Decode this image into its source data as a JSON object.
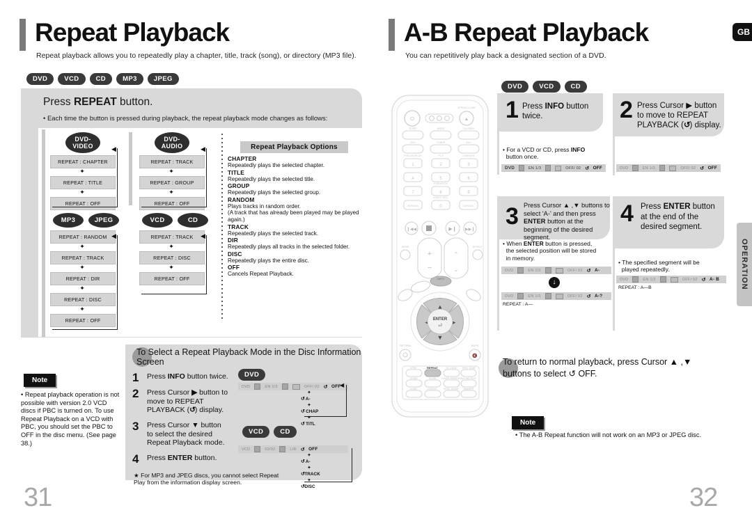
{
  "left_page": {
    "number": "31",
    "title": "Repeat Playback",
    "subtitle": "Repeat playback allows you to repeatedly play a chapter, title, track (song), or directory (MP3 file).",
    "disc_chips": [
      "DVD",
      "VCD",
      "CD",
      "MP3",
      "JPEG"
    ],
    "instruction_heading_pre": "Press ",
    "instruction_heading_bold": "REPEAT",
    "instruction_heading_post": " button.",
    "instruction_bullet": "• Each time the button is pressed during playback, the repeat playback mode changes as follows:",
    "flows": [
      {
        "label": "DVD-\nVIDEO",
        "label_line1": "DVD-",
        "label_line2": "VIDEO",
        "steps": [
          "REPEAT : CHAPTER",
          "REPEAT : TITLE",
          "REPEAT : OFF"
        ]
      },
      {
        "label_line1": "DVD-",
        "label_line2": "AUDIO",
        "steps": [
          "REPEAT : TRACK",
          "REPEAT : GROUP",
          "REPEAT : OFF"
        ]
      },
      {
        "labels": [
          "MP3",
          "JPEG"
        ],
        "steps": [
          "REPEAT : RANDOM",
          "REPEAT : TRACK",
          "REPEAT : DIR",
          "REPEAT : DISC",
          "REPEAT : OFF"
        ]
      },
      {
        "labels": [
          "VCD",
          "CD"
        ],
        "steps": [
          "REPEAT : TRACK",
          "REPEAT : DISC",
          "REPEAT : OFF"
        ]
      }
    ],
    "options": {
      "heading": "Repeat Playback Options",
      "items": [
        {
          "term": "CHAPTER",
          "desc": "Repeatedly plays the selected chapter."
        },
        {
          "term": "TITLE",
          "desc": "Repeatedly plays the selected title."
        },
        {
          "term": "GROUP",
          "desc": "Repeatedly plays the selected group."
        },
        {
          "term": "RANDOM",
          "desc": "Plays tracks in random order.\n(A track that has already been played may be played again.)"
        },
        {
          "term": "TRACK",
          "desc": "Repeatedly plays the selected track."
        },
        {
          "term": "DIR",
          "desc": "Repeatedly plays all tracks in the selected folder."
        },
        {
          "term": "DISC",
          "desc": "Repeatedly plays the entire disc."
        },
        {
          "term": "OFF",
          "desc": "Cancels Repeat Playback."
        }
      ]
    },
    "note": {
      "tag": "Note",
      "text": "• Repeat playback operation is not possible with version 2.0 VCD discs if PBC is turned on. To use Repeat Playback on a VCD with PBC, you should set the PBC to OFF in the disc menu. (See page 38.)"
    },
    "subsection": {
      "heading": "To Select a Repeat Playback Mode in the Disc Information Screen",
      "steps": [
        {
          "num": "1",
          "text": "Press INFO button twice."
        },
        {
          "num": "2",
          "text": "Press Cursor ▶ button to move to REPEAT PLAYBACK ( ↺ ) display."
        },
        {
          "num": "3",
          "text": "Press Cursor ▼ button to select the desired Repeat Playback mode."
        },
        {
          "num": "4",
          "text": "Press ENTER button."
        }
      ],
      "footnote": "★ For MP3 and JPEG discs, you cannot select Repeat Play from the information display screen.",
      "dvd_chip": "DVD",
      "vcd_chips": [
        "VCD",
        "CD"
      ],
      "dvd_osd": {
        "fields": [
          "DVD",
          "EN 1/3",
          "OFF/ 02"
        ],
        "repeat": "OFF"
      },
      "dvd_menu": [
        "OFF",
        "A-",
        "CHAP",
        "TITL"
      ],
      "vcd_osd": {
        "fields": [
          "VCD",
          "02/02",
          "L/R"
        ],
        "repeat": "OFF"
      },
      "vcd_menu": [
        "OFF",
        "A-",
        "TRACK",
        "DISC"
      ]
    }
  },
  "right_page": {
    "number": "32",
    "title": "A-B Repeat Playback",
    "subtitle": "You can repetitively play back a designated section of a DVD.",
    "disc_chips": [
      "DVD",
      "VCD",
      "CD"
    ],
    "region_tab": "GB",
    "side_tab": "OPERATION",
    "steps": [
      {
        "num": "1",
        "text_html": "Press <b>INFO</b> button twice.",
        "note": "• For a VCD or CD, press <b>INFO</b> button once.",
        "osd": {
          "fields": [
            "DVD",
            "EN 1/3",
            "OFF/ 02"
          ],
          "repeat": "OFF"
        }
      },
      {
        "num": "2",
        "text_html": "Press Cursor ▶ button to move to REPEAT PLAYBACK ( ↺ ) display.",
        "note": "",
        "osd": {
          "fields": [
            "DVD",
            "EN 1/3",
            "OFF/ 02"
          ],
          "repeat": "OFF"
        }
      },
      {
        "num": "3",
        "text_html": "Press Cursor ▲ , ▼ buttons to select 'A-' and then press <b>ENTER</b> button at the beginning of the desired segment.",
        "note": "• When <b>ENTER</b> button is pressed, the selected position will be stored in memory.",
        "osd": {
          "fields": [
            "DVD",
            "EN 1/3",
            "OFF/ 02"
          ],
          "repeat": "A-"
        },
        "osd2": {
          "fields": [
            "DVD",
            "EN 1/3",
            "OFF/ 02"
          ],
          "repeat": "A-?"
        },
        "osd2_caption": "REPEAT : A—"
      },
      {
        "num": "4",
        "text_html": "Press <b>ENTER</b> button at the end of the desired segment.",
        "note": "• The specified segment will be played repeatedly.",
        "osd": {
          "fields": [
            "DVD",
            "EN 1/3",
            "OFF/ 02"
          ],
          "repeat": "A- B"
        },
        "osd_caption": "REPEAT : A—B"
      }
    ],
    "return_text": "To return to normal playback, press Cursor ▲ ,▼ buttons to select ↺ OFF.",
    "note": {
      "tag": "Note",
      "text": "• The A-B Repeat function will not work on an MP3 or JPEG disc."
    }
  },
  "remote": {
    "name": "remote-control-illustration",
    "highlight_button": "REPEAT",
    "center_button": "ENTER"
  },
  "colors": {
    "panel_gray": "#d9d9d9",
    "chip_dark": "#3a3a3a",
    "osd_gray": "#cfcfcf",
    "page_num_gray": "#a8a8a8",
    "title_bar": "#7a7a7a"
  }
}
